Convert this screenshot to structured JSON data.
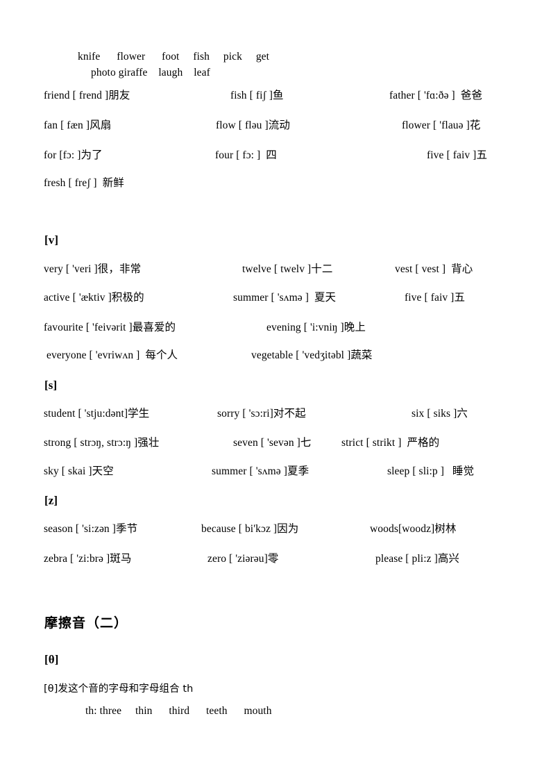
{
  "document": {
    "page_background": "#ffffff",
    "text_color": "#000000"
  },
  "top_word_list": {
    "line1": "knife      flower      foot     fish     pick     get",
    "line2": "photo giraffe    laugh    leaf"
  },
  "f_section": {
    "rows": [
      {
        "col1": "friend [ frend ]朋友",
        "col2": "fish [ fiʃ ]鱼",
        "col3": "father [ 'fɑ:ðə ]  爸爸"
      },
      {
        "col1": "fan [ fæn ]风扇",
        "col2": "flow [ fləu ]流动",
        "col3": "flower [ 'flauə ]花"
      },
      {
        "col1": "for [fɔ: ]为了",
        "col2": "four [ fɔ: ]  四",
        "col3": "five [ faiv ]五"
      },
      {
        "col1": "fresh [ freʃ ]  新鲜",
        "col2": "",
        "col3": ""
      }
    ]
  },
  "v_section": {
    "heading": "[v]",
    "rows": [
      {
        "col1": "very [ 'veri ]很，非常",
        "col2": "twelve [ twelv ]十二",
        "col3": "vest [ vest ]  背心"
      },
      {
        "col1": "active [ 'æktiv ]积极的",
        "col2": "summer [ 'sʌmə ]  夏天",
        "col3": "five [ faiv ]五"
      },
      {
        "col1": "favourite [ 'feivərit ]最喜爱的",
        "col2": "evening [ 'i:vniŋ ]晚上",
        "col3": ""
      },
      {
        "col1": " everyone [ 'evriwʌn ]  每个人",
        "col2": "vegetable [ 'vedʒitəbl ]蔬菜",
        "col3": ""
      }
    ]
  },
  "s_section": {
    "heading": "[s]",
    "rows": [
      {
        "col1": "student [ 'stju:dənt]学生",
        "col2": "sorry [ 'sɔ:ri]对不起",
        "col3": "six [ siks ]六"
      },
      {
        "col1": "strong [ strɔŋ, strɔ:ŋ ]强壮",
        "col2": "seven [ 'sevən ]七",
        "col3": "strict [ strikt ]  严格的"
      },
      {
        "col1": "sky [ skai ]天空",
        "col2": "summer [ 'sʌmə ]夏季",
        "col3": "sleep [ sli:p ]   睡觉"
      }
    ]
  },
  "z_section": {
    "heading": "[z]",
    "rows": [
      {
        "col1": "season [ 'si:zən ]季节",
        "col2": "because [ bi'kɔz ]因为",
        "col3": "woods[woodz]树林"
      },
      {
        "col1": "zebra [ 'zi:brə ]斑马",
        "col2": "zero [ 'ziərəu]零",
        "col3": "please [ pli:z ]高兴"
      }
    ]
  },
  "fricatives_two": {
    "section_title": "摩擦音（二）",
    "theta_heading": "[θ]",
    "note": "[θ]发这个音的字母和字母组合 th",
    "examples": "th: three     thin      third      teeth      mouth"
  }
}
